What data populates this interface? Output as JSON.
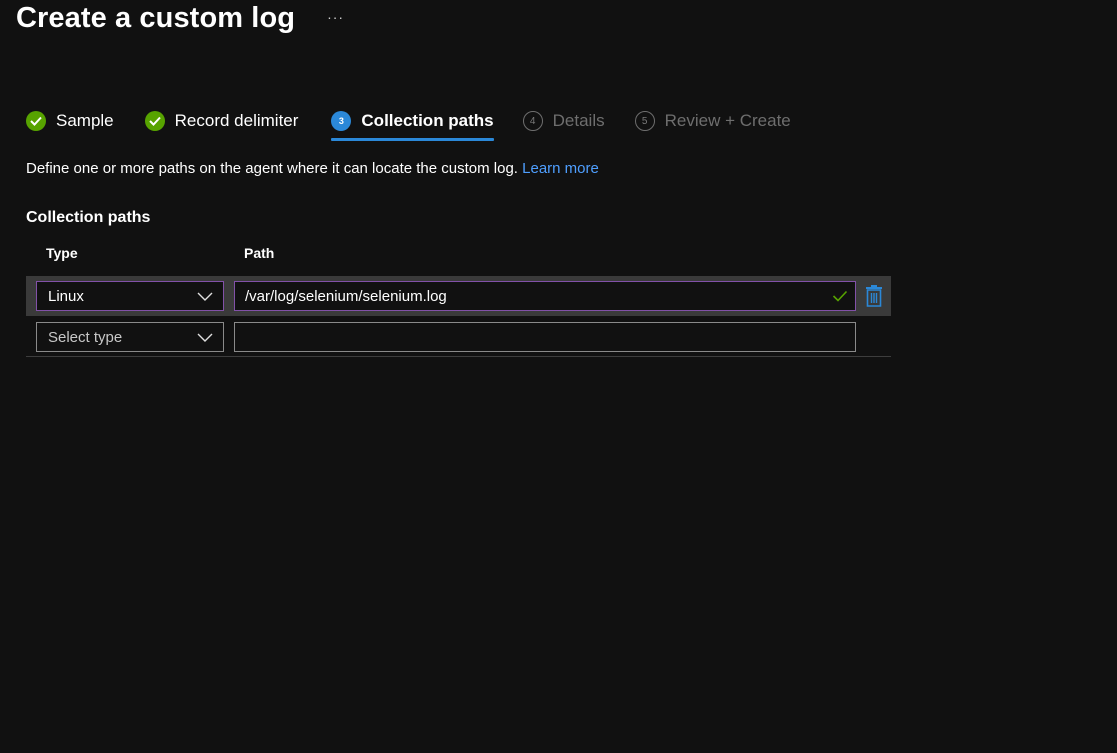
{
  "header": {
    "title": "Create a custom log",
    "more_label": "···"
  },
  "wizard": {
    "steps": [
      {
        "label": "Sample",
        "state": "done",
        "indicator": "check-circle-icon"
      },
      {
        "label": "Record delimiter",
        "state": "done",
        "indicator": "check-circle-icon"
      },
      {
        "label": "Collection paths",
        "state": "current",
        "number": "3"
      },
      {
        "label": "Details",
        "state": "pending",
        "number": "4"
      },
      {
        "label": "Review + Create",
        "state": "pending",
        "number": "5"
      }
    ]
  },
  "description": {
    "text": "Define one or more paths on the agent where it can locate the custom log. ",
    "link": "Learn more"
  },
  "collection": {
    "section_title": "Collection paths",
    "columns": {
      "type": "Type",
      "path": "Path"
    },
    "rows": [
      {
        "type": "Linux",
        "path": "/var/log/selenium/selenium.log",
        "valid": true
      },
      {
        "type_placeholder": "Select type",
        "path": ""
      }
    ]
  },
  "colors": {
    "background": "#111111",
    "accent": "#2b88d8",
    "success": "#57a300",
    "link": "#4f9fff",
    "focus_border": "#8251a8",
    "delete_icon": "#2b88d8"
  }
}
